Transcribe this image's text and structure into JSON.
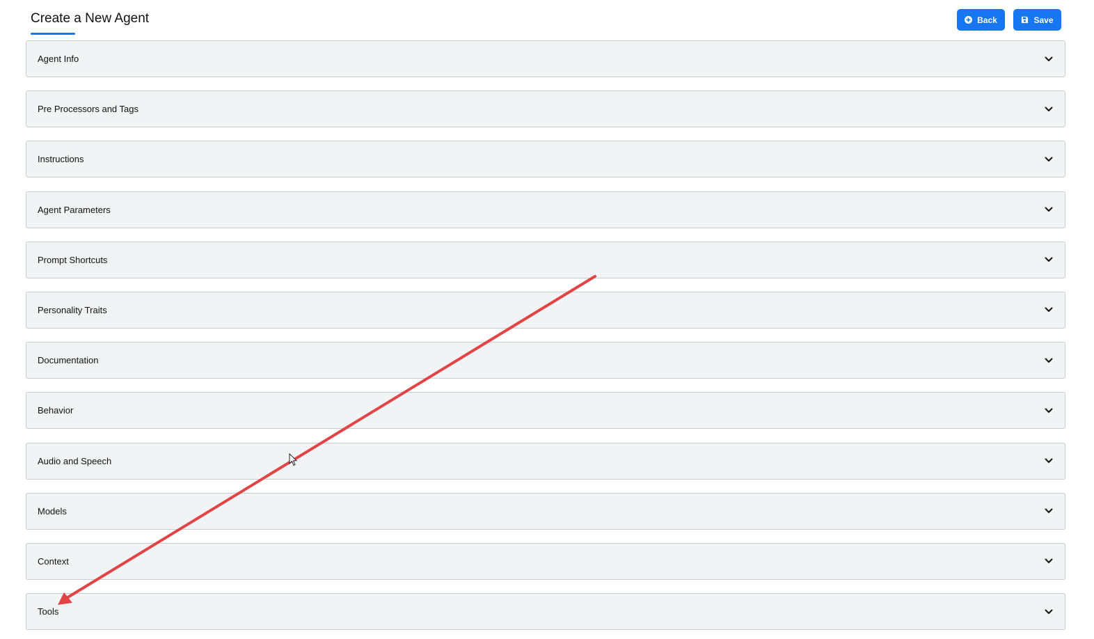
{
  "header": {
    "title": "Create a New Agent",
    "back_label": "Back",
    "save_label": "Save",
    "back_icon": "plus-circle-icon",
    "save_icon": "floppy-disk-icon"
  },
  "sections": [
    {
      "label": "Agent Info"
    },
    {
      "label": "Pre Processors and Tags"
    },
    {
      "label": "Instructions"
    },
    {
      "label": "Agent Parameters"
    },
    {
      "label": "Prompt Shortcuts"
    },
    {
      "label": "Personality Traits"
    },
    {
      "label": "Documentation"
    },
    {
      "label": "Behavior"
    },
    {
      "label": "Audio and Speech"
    },
    {
      "label": "Models"
    },
    {
      "label": "Context"
    },
    {
      "label": "Tools"
    }
  ],
  "colors": {
    "accent": "#1677f0",
    "section_bg": "#f2f3f5",
    "section_border": "#c9ccd1",
    "annotation_arrow": "#e04444"
  }
}
